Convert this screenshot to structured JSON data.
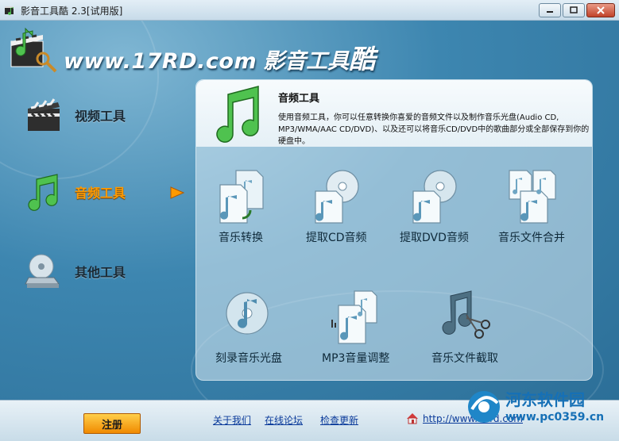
{
  "window": {
    "title": "影音工具酷 2.3[试用版]"
  },
  "header": {
    "site": "www.17RD.com",
    "brand_cn": "影音工具",
    "brand_cn_big": "酷"
  },
  "sidebar": {
    "items": [
      {
        "label": "视频工具",
        "icon": "film-clapper-icon",
        "active": false
      },
      {
        "label": "音频工具",
        "icon": "music-note-icon",
        "active": true
      },
      {
        "label": "其他工具",
        "icon": "disc-drive-icon",
        "active": false
      }
    ]
  },
  "panel": {
    "title": "音频工具",
    "description": "使用音频工具，你可以任意转换你喜爱的音频文件以及制作音乐光盘(Audio CD, MP3/WMA/AAC CD/DVD)、以及还可以将音乐CD/DVD中的歌曲部分或全部保存到你的硬盘中。",
    "tools": [
      {
        "label": "音乐转换",
        "icon": "music-convert-icon"
      },
      {
        "label": "提取CD音频",
        "icon": "cd-extract-icon"
      },
      {
        "label": "提取DVD音频",
        "icon": "dvd-extract-icon"
      },
      {
        "label": "音乐文件合并",
        "icon": "music-merge-icon"
      },
      {
        "label": "刻录音乐光盘",
        "icon": "burn-disc-icon"
      },
      {
        "label": "MP3音量调整",
        "icon": "volume-adjust-icon"
      },
      {
        "label": "音乐文件截取",
        "icon": "music-cut-icon"
      }
    ]
  },
  "footer": {
    "register": "注册",
    "links": [
      "关于我们",
      "在线论坛",
      "检查更新"
    ],
    "url": "http://www.17rd.com"
  },
  "watermark": {
    "cn": "河东软件园",
    "url": "www.pc0359.cn"
  },
  "colors": {
    "accent_orange": "#ff9a00",
    "panel_bg": "#e5f0f6",
    "link_blue": "#0a3a9a"
  }
}
